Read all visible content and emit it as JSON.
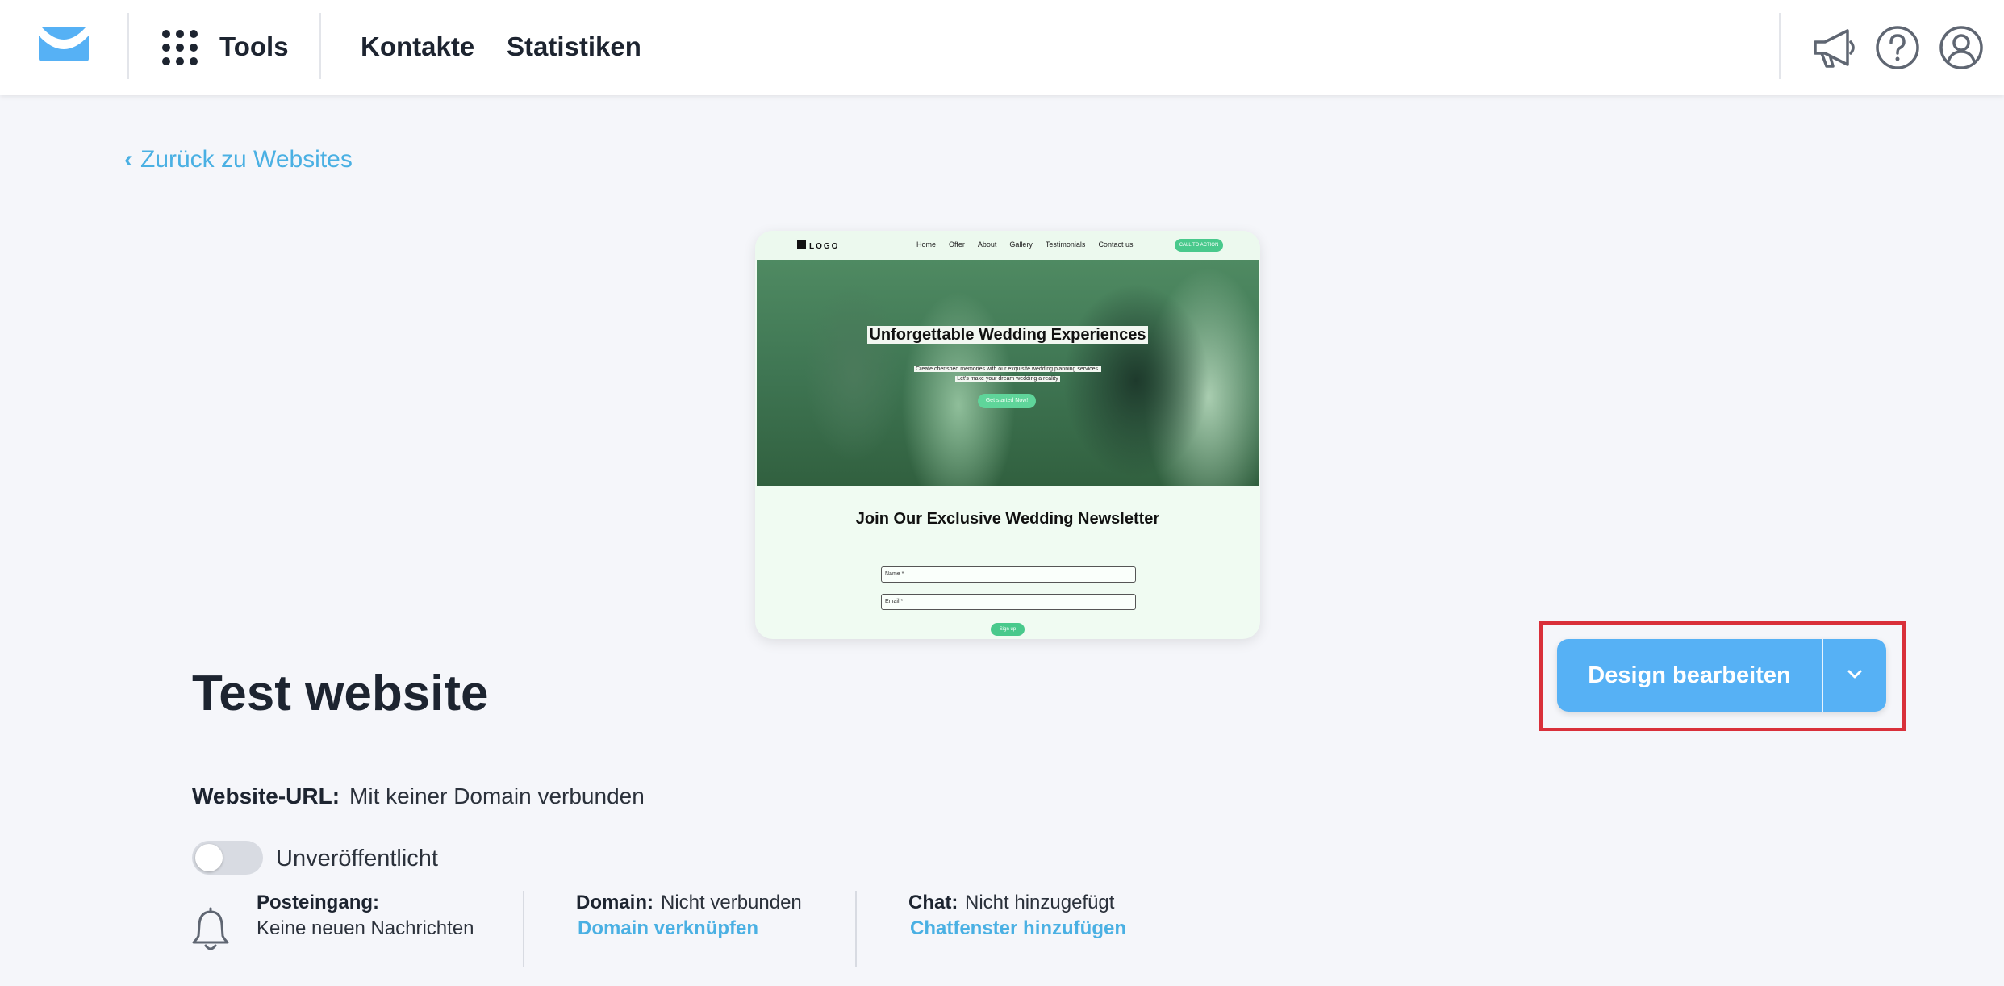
{
  "colors": {
    "brand_blue": "#56b1f5",
    "link_blue": "#4ab0e3",
    "highlight_red": "#d9303a",
    "preview_green": "#49c98c"
  },
  "header": {
    "brand_icon": "envelope-logo-icon",
    "apps_icon": "apps-grid-icon",
    "tools": "Tools",
    "contacts": "Kontakte",
    "statistics": "Statistiken",
    "right_icons": [
      "megaphone-icon",
      "help-circle-icon",
      "user-avatar-icon"
    ]
  },
  "back_link": {
    "label": "Zurück zu Websites"
  },
  "preview": {
    "logo": "LOGO",
    "nav_links": [
      "Home",
      "Offer",
      "About",
      "Gallery",
      "Testimonials",
      "Contact us"
    ],
    "nav_cta": "CALL TO ACTION",
    "hero_title": "Unforgettable Wedding Experiences",
    "hero_sub_1": "Create cherished memories with our exquisite wedding planning services.",
    "hero_sub_2": "Let's make your dream wedding a reality",
    "hero_button": "Get started Now!",
    "newsletter_title": "Join Our Exclusive Wedding Newsletter",
    "name_placeholder": "Name *",
    "email_placeholder": "Email *",
    "signup_button": "Sign up"
  },
  "site": {
    "title": "Test website",
    "url_label": "Website-URL:",
    "url_value": "Mit keiner Domain verbunden",
    "publish_state": "Unveröffentlicht",
    "published": false
  },
  "design_button": {
    "label": "Design bearbeiten",
    "caret_icon": "chevron-down-icon"
  },
  "status": {
    "inbox_label": "Posteingang:",
    "inbox_value": "Keine neuen Nachrichten",
    "domain_label": "Domain:",
    "domain_value": "Nicht verbunden",
    "domain_link": "Domain verknüpfen",
    "chat_label": "Chat:",
    "chat_value": "Nicht hinzugefügt",
    "chat_link": "Chatfenster hinzufügen"
  }
}
